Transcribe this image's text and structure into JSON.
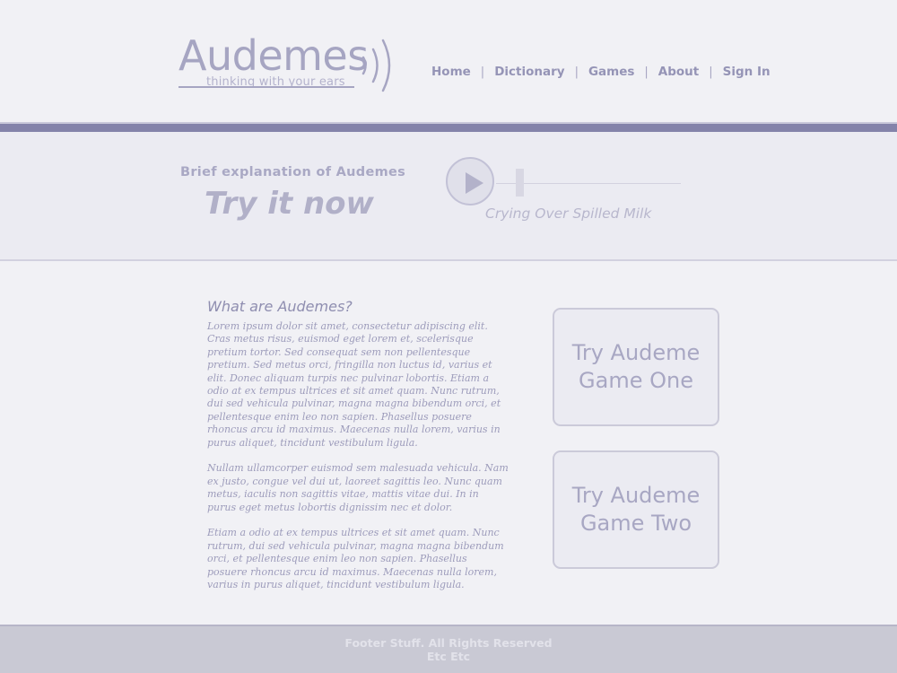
{
  "colors": {
    "accent_bar": "#8483aa",
    "background": "#f1f1f5",
    "hero_background": "#ebebf2",
    "footer_background": "#c9c9d4",
    "text_muted": "#a6a5c2"
  },
  "logo": {
    "wordmark": "Audemes",
    "tagline": "thinking with your ears",
    "icon": "sound-waves-icon"
  },
  "nav": {
    "items": [
      {
        "label": "Home"
      },
      {
        "label": "Dictionary"
      },
      {
        "label": "Games"
      },
      {
        "label": "About"
      },
      {
        "label": "Sign In"
      }
    ],
    "separator": "|"
  },
  "hero": {
    "brief": "Brief explanation of Audemes",
    "cta": "Try it now",
    "player": {
      "play_icon": "play-icon",
      "track_title": "Crying Over Spilled Milk"
    }
  },
  "about": {
    "title": "What are Audemes?",
    "paragraphs": [
      "Lorem ipsum dolor sit amet, consectetur adipiscing elit. Cras metus risus, euismod eget lorem et, scelerisque pretium tortor. Sed consequat sem non pellentesque pretium. Sed metus orci, fringilla non luctus id, varius et elit. Donec aliquam turpis nec pulvinar lobortis. Etiam a odio at ex tempus ultrices et sit amet quam. Nunc rutrum, dui sed vehicula pulvinar, magna magna bibendum orci, et pellentesque enim leo non sapien. Phasellus posuere rhoncus arcu id maximus. Maecenas nulla lorem, varius in purus aliquet, tincidunt vestibulum ligula.",
      "Nullam ullamcorper euismod sem malesuada vehicula. Nam ex justo, congue vel dui ut, laoreet sagittis leo. Nunc quam metus, iaculis non sagittis vitae, mattis vitae dui. In in purus eget metus lobortis dignissim nec et dolor.",
      "Etiam a odio at ex tempus ultrices et sit amet quam. Nunc rutrum, dui sed vehicula pulvinar, magna magna bibendum orci, et pellentesque enim leo non sapien. Phasellus posuere rhoncus arcu id maximus. Maecenas nulla lorem, varius in purus aliquet, tincidunt vestibulum ligula."
    ]
  },
  "games": [
    {
      "line1": "Try Audeme",
      "line2": "Game One"
    },
    {
      "line1": "Try Audeme",
      "line2": "Game Two"
    }
  ],
  "footer": {
    "line1": "Footer Stuff. All Rights Reserved",
    "line2": "Etc Etc"
  }
}
